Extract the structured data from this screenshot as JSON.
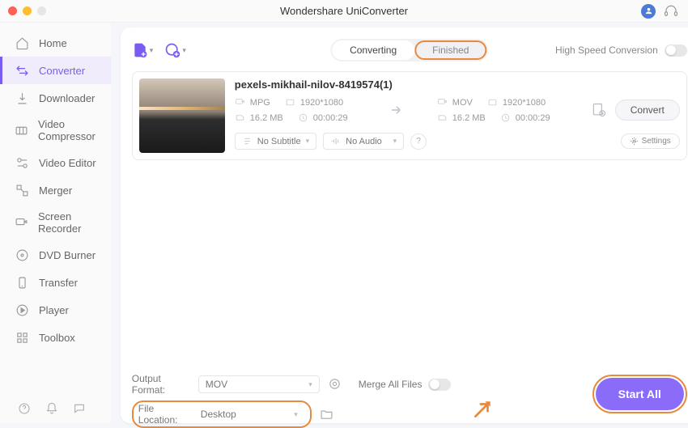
{
  "app_title": "Wondershare UniConverter",
  "sidebar": {
    "items": [
      {
        "label": "Home"
      },
      {
        "label": "Converter"
      },
      {
        "label": "Downloader"
      },
      {
        "label": "Video Compressor"
      },
      {
        "label": "Video Editor"
      },
      {
        "label": "Merger"
      },
      {
        "label": "Screen Recorder"
      },
      {
        "label": "DVD Burner"
      },
      {
        "label": "Transfer"
      },
      {
        "label": "Player"
      },
      {
        "label": "Toolbox"
      }
    ]
  },
  "topbar": {
    "tabs": {
      "converting": "Converting",
      "finished": "Finished"
    },
    "high_speed_label": "High Speed Conversion"
  },
  "file": {
    "name": "pexels-mikhail-nilov-8419574(1)",
    "source": {
      "format": "MPG",
      "resolution": "1920*1080",
      "size": "16.2 MB",
      "duration": "00:00:29"
    },
    "target": {
      "format": "MOV",
      "resolution": "1920*1080",
      "size": "16.2 MB",
      "duration": "00:00:29"
    },
    "subtitle_value": "No Subtitle",
    "audio_value": "No Audio",
    "settings_label": "Settings",
    "convert_label": "Convert"
  },
  "bottom": {
    "output_format_label": "Output Format:",
    "output_format_value": "MOV",
    "file_location_label": "File Location:",
    "file_location_value": "Desktop",
    "merge_label": "Merge All Files",
    "start_all_label": "Start All"
  }
}
